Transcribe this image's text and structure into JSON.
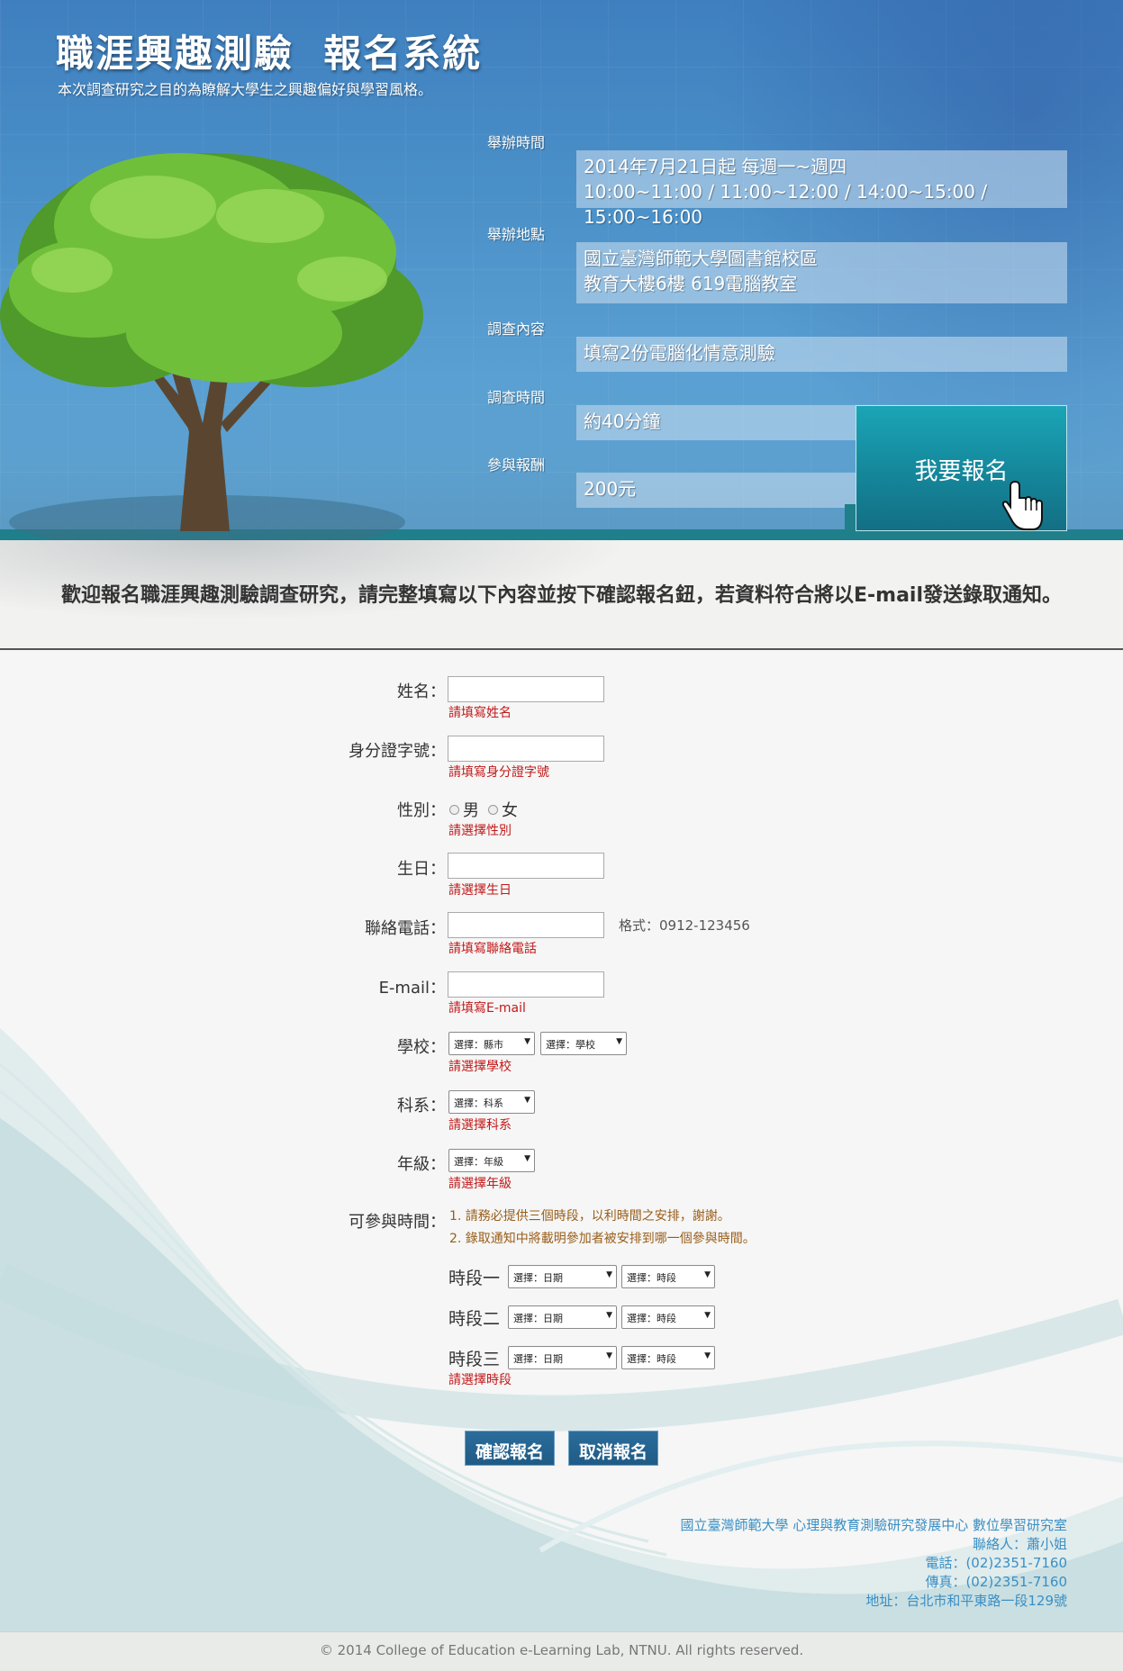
{
  "header": {
    "title": "職涯興趣測驗  報名系統",
    "subtitle": "本次調查研究之目的為瞭解大學生之興趣偏好與學習風格。",
    "info": [
      {
        "label": "舉辦時間",
        "lines": [
          "2014年7月21日起 每週一~週四",
          "10:00~11:00 / 11:00~12:00 / 14:00~15:00 / 15:00~16:00"
        ]
      },
      {
        "label": "舉辦地點",
        "lines": [
          "國立臺灣師範大學圖書館校區",
          "教育大樓6樓 619電腦教室"
        ]
      },
      {
        "label": "調查內容",
        "lines": [
          "填寫2份電腦化情意測驗"
        ]
      },
      {
        "label": "調查時間",
        "lines": [
          "約40分鐘"
        ]
      },
      {
        "label": "參與報酬",
        "lines": [
          "200元"
        ]
      }
    ],
    "signup_button": "我要報名"
  },
  "welcome": "歡迎報名職涯興趣測驗調查研究，請完整填寫以下內容並按下確認報名鈕，若資料符合將以E-mail發送錄取通知。",
  "form": {
    "name": {
      "label": "姓名：",
      "error": "請填寫姓名"
    },
    "id_number": {
      "label": "身分證字號：",
      "error": "請填寫身分證字號"
    },
    "gender": {
      "label": "性別：",
      "male": "男",
      "female": "女",
      "error": "請選擇性別"
    },
    "birthday": {
      "label": "生日：",
      "error": "請選擇生日"
    },
    "phone": {
      "label": "聯絡電話：",
      "hint": "格式：0912-123456",
      "error": "請填寫聯絡電話"
    },
    "email": {
      "label": "E-mail：",
      "error": "請填寫E-mail"
    },
    "school": {
      "label": "學校：",
      "city_select": "選擇：縣市",
      "school_select": "選擇：學校",
      "error": "請選擇學校"
    },
    "department": {
      "label": "科系：",
      "select": "選擇：科系",
      "error": "請選擇科系"
    },
    "grade": {
      "label": "年級：",
      "select": "選擇：年級",
      "error": "請選擇年級"
    },
    "availability": {
      "label": "可參與時間：",
      "notes": [
        "1. 請務必提供三個時段，以利時間之安排，謝謝。",
        "2. 錄取通知中將載明參加者被安排到哪一個參與時間。"
      ],
      "slots": [
        {
          "label": "時段一",
          "date_select": "選擇：日期",
          "time_select": "選擇：時段"
        },
        {
          "label": "時段二",
          "date_select": "選擇：日期",
          "time_select": "選擇：時段"
        },
        {
          "label": "時段三",
          "date_select": "選擇：日期",
          "time_select": "選擇：時段"
        }
      ],
      "error": "請選擇時段"
    },
    "confirm_button": "確認報名",
    "cancel_button": "取消報名"
  },
  "contact": {
    "org": "國立臺灣師範大學 心理與教育測驗研究發展中心 數位學習研究室",
    "person": "聯絡人：蕭小姐",
    "phone": "電話：(02)2351-7160",
    "fax": "傳真：(02)2351-7160",
    "address": "地址：台北市和平東路一段129號"
  },
  "footer": {
    "copyright": "© 2014 College of Education e-Learning Lab, NTNU. All rights reserved."
  },
  "colors": {
    "header_blue": "#4a90c8",
    "signup_teal": "#15869a",
    "error_red": "#c2191b",
    "note_brown": "#9a5d1a",
    "button_blue": "#1f5b86",
    "contact_blue": "#3a8fc5"
  }
}
